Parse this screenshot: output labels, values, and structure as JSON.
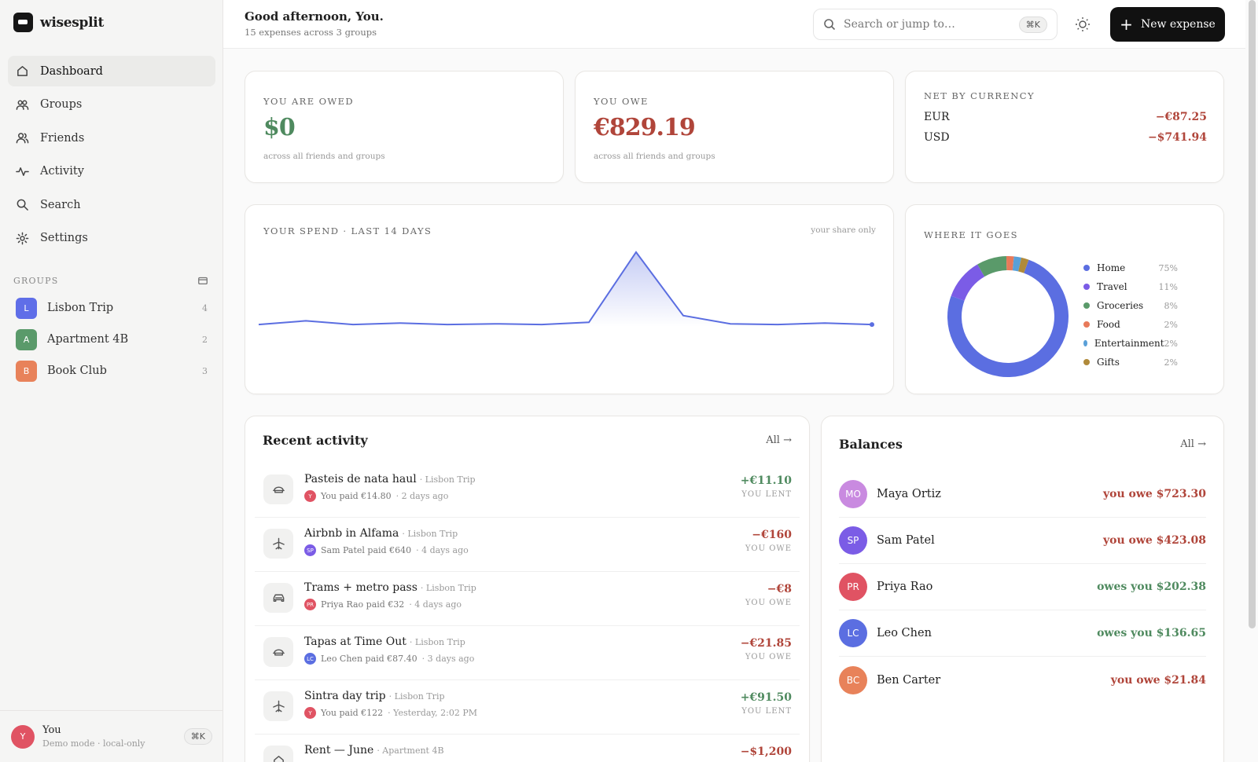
{
  "app": {
    "name": "wisesplit"
  },
  "nav": [
    {
      "label": "Dashboard",
      "icon": "home-icon",
      "active": true
    },
    {
      "label": "Groups",
      "icon": "groups-icon"
    },
    {
      "label": "Friends",
      "icon": "friends-icon"
    },
    {
      "label": "Activity",
      "icon": "activity-icon"
    },
    {
      "label": "Search",
      "icon": "search-icon"
    },
    {
      "label": "Settings",
      "icon": "gear-icon"
    }
  ],
  "groups_section": {
    "label": "GROUPS"
  },
  "groups": [
    {
      "initial": "L",
      "name": "Lisbon Trip",
      "count": "4",
      "color": "#5f6ee8"
    },
    {
      "initial": "A",
      "name": "Apartment 4B",
      "count": "2",
      "color": "#5a9a6a"
    },
    {
      "initial": "B",
      "name": "Book Club",
      "count": "3",
      "color": "#e8825a"
    }
  ],
  "user": {
    "initial": "Y",
    "name": "You",
    "sub": "Demo mode · local-only",
    "shortcut": "⌘K"
  },
  "header": {
    "greeting": "Good afternoon, You.",
    "subtitle": "15 expenses across 3 groups"
  },
  "search": {
    "placeholder": "Search or jump to…",
    "shortcut": "⌘K"
  },
  "new_expense": {
    "label": "New expense"
  },
  "owed": {
    "label": "YOU ARE OWED",
    "value": "$0",
    "note": "across all friends and groups"
  },
  "owe": {
    "label": "YOU OWE",
    "value": "€829.19",
    "note": "across all friends and groups"
  },
  "net": {
    "label": "NET BY CURRENCY",
    "rows": [
      {
        "currency": "EUR",
        "value": "−€87.25"
      },
      {
        "currency": "USD",
        "value": "−$741.94"
      }
    ]
  },
  "spend": {
    "label": "YOUR SPEND · LAST 14 DAYS",
    "note": "your share only"
  },
  "where": {
    "label": "WHERE IT GOES"
  },
  "chart_data": [
    {
      "type": "area",
      "title": "YOUR SPEND · LAST 14 DAYS",
      "x": [
        1,
        2,
        3,
        4,
        5,
        6,
        7,
        8,
        9,
        10,
        11,
        12,
        13,
        14
      ],
      "values": [
        3,
        8,
        3,
        5,
        3,
        4,
        3,
        6,
        100,
        15,
        4,
        3,
        5,
        3
      ],
      "color": "#5b6ee1"
    },
    {
      "type": "pie",
      "title": "WHERE IT GOES",
      "categories": [
        "Home",
        "Travel",
        "Groceries",
        "Food",
        "Entertainment",
        "Gifts"
      ],
      "values": [
        75,
        11,
        8,
        2,
        2,
        2
      ],
      "labels": [
        "75%",
        "11%",
        "8%",
        "2%",
        "2%",
        "2%"
      ],
      "colors": [
        "#5b6ee1",
        "#7b5ce6",
        "#5a9a6a",
        "#e87a5a",
        "#5aa0d8",
        "#b08a3a"
      ]
    }
  ],
  "activity": {
    "title": "Recent activity",
    "all_label": "All →",
    "items": [
      {
        "icon": "food-icon",
        "title": "Pasteis de nata haul",
        "group": "· Lisbon Trip",
        "payer_initial": "Y",
        "payer_color": "#e05363",
        "paid": "You paid €14.80",
        "when": "· 2 days ago",
        "amount": "+€11.10",
        "kind": "YOU LENT",
        "positive": true
      },
      {
        "icon": "plane-icon",
        "title": "Airbnb in Alfama",
        "group": "· Lisbon Trip",
        "payer_initial": "SP",
        "payer_color": "#7b5ce6",
        "paid": "Sam Patel paid €640",
        "when": "· 4 days ago",
        "amount": "−€160",
        "kind": "YOU OWE",
        "positive": false
      },
      {
        "icon": "car-icon",
        "title": "Trams + metro pass",
        "group": "· Lisbon Trip",
        "payer_initial": "PR",
        "payer_color": "#e05363",
        "paid": "Priya Rao paid €32",
        "when": "· 4 days ago",
        "amount": "−€8",
        "kind": "YOU OWE",
        "positive": false
      },
      {
        "icon": "food-icon",
        "title": "Tapas at Time Out",
        "group": "· Lisbon Trip",
        "payer_initial": "LC",
        "payer_color": "#5b6ee1",
        "paid": "Leo Chen paid €87.40",
        "when": "· 3 days ago",
        "amount": "−€21.85",
        "kind": "YOU OWE",
        "positive": false
      },
      {
        "icon": "plane-icon",
        "title": "Sintra day trip",
        "group": "· Lisbon Trip",
        "payer_initial": "Y",
        "payer_color": "#e05363",
        "paid": "You paid €122",
        "when": "· Yesterday, 2:02 PM",
        "amount": "+€91.50",
        "kind": "YOU LENT",
        "positive": true
      },
      {
        "icon": "home-icon",
        "title": "Rent — June",
        "group": "· Apartment 4B",
        "payer_initial": "",
        "payer_color": "#888888",
        "paid": "",
        "when": "",
        "amount": "−$1,200",
        "kind": "",
        "positive": false
      }
    ]
  },
  "balances": {
    "title": "Balances",
    "all_label": "All →",
    "items": [
      {
        "initials": "MO",
        "name": "Maya Ortiz",
        "text": "you owe $723.30",
        "positive": false,
        "color": "#c98ae0"
      },
      {
        "initials": "SP",
        "name": "Sam Patel",
        "text": "you owe $423.08",
        "positive": false,
        "color": "#7b5ce6"
      },
      {
        "initials": "PR",
        "name": "Priya Rao",
        "text": "owes you $202.38",
        "positive": true,
        "color": "#e05363"
      },
      {
        "initials": "LC",
        "name": "Leo Chen",
        "text": "owes you $136.65",
        "positive": true,
        "color": "#5b6ee1"
      },
      {
        "initials": "BC",
        "name": "Ben Carter",
        "text": "you owe $21.84",
        "positive": false,
        "color": "#e8825a"
      }
    ]
  }
}
